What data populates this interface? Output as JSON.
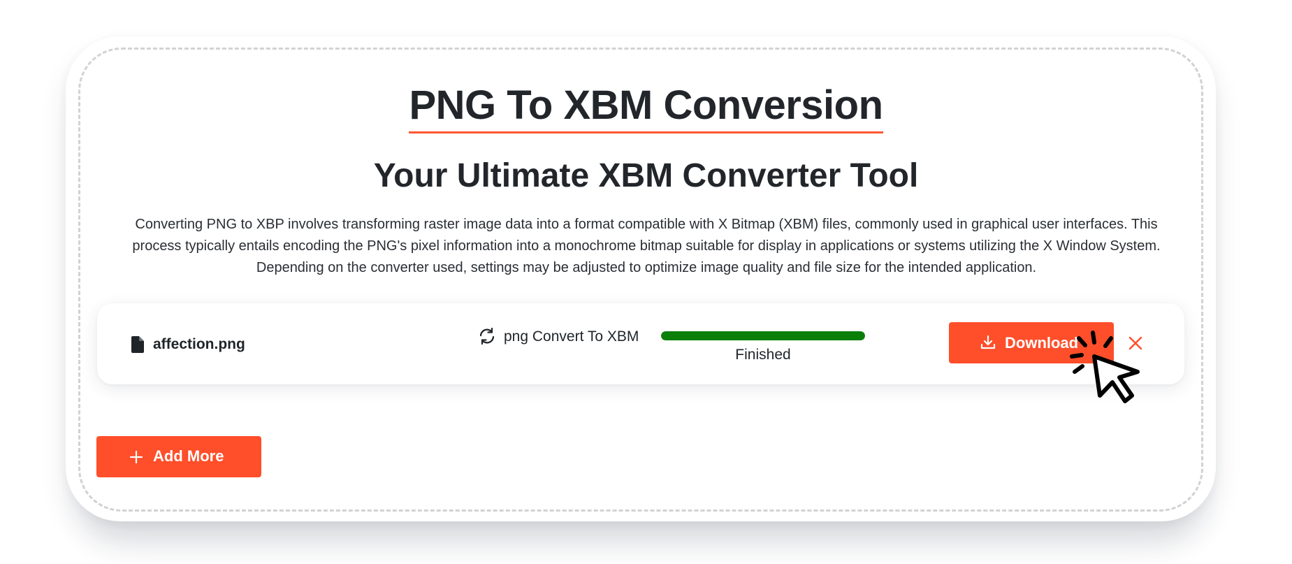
{
  "header": {
    "title": "PNG To XBM Conversion",
    "subtitle": "Your Ultimate XBM Converter Tool",
    "description": "Converting PNG to XBP involves transforming raster image data into a format compatible with X Bitmap (XBM) files, commonly used in graphical user interfaces. This process typically entails encoding the PNG's pixel information into a monochrome bitmap suitable for display in applications or systems utilizing the X Window System. Depending on the converter used, settings may be adjusted to optimize image quality and file size for the intended application."
  },
  "file": {
    "name": "affection.png",
    "icon": "file-icon",
    "conversion_label": "png Convert To XBM",
    "conversion_icon": "refresh-icon",
    "progress_percent": 100,
    "status": "Finished",
    "download_label": "Download",
    "download_icon": "download-icon",
    "remove_icon": "close-icon"
  },
  "actions": {
    "add_more_label": "Add More",
    "add_more_icon": "plus-icon"
  },
  "colors": {
    "accent": "#ff4e2a",
    "progress": "#0a7f0a",
    "text": "#1f2429"
  }
}
